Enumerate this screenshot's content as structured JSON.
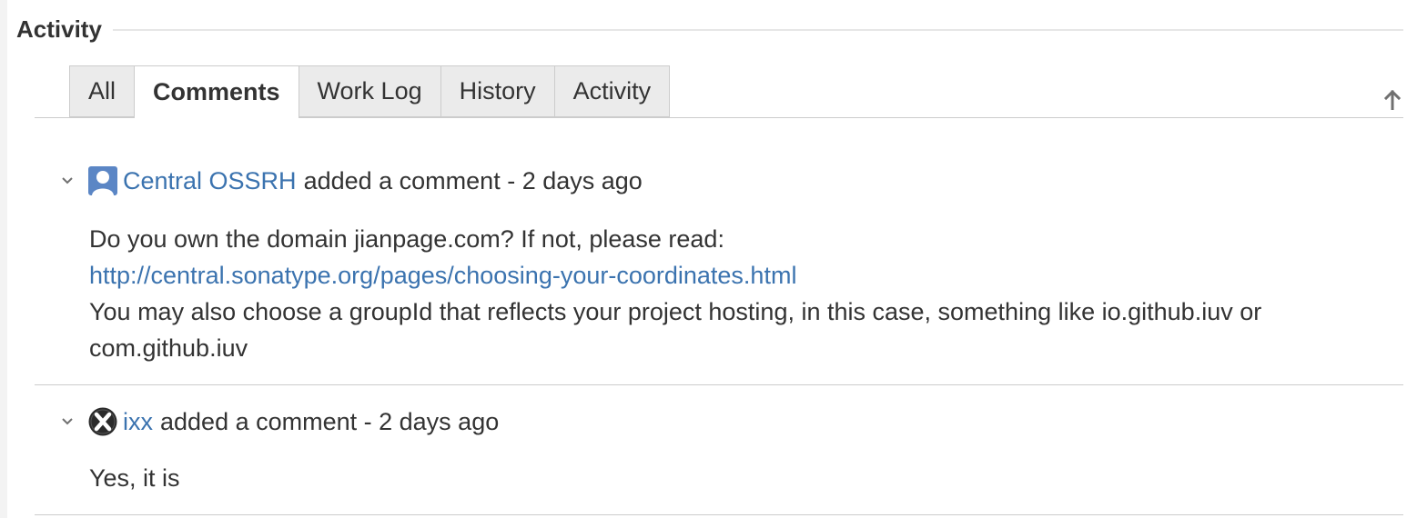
{
  "module": {
    "title": "Activity"
  },
  "tabs": [
    {
      "label": "All",
      "active": false
    },
    {
      "label": "Comments",
      "active": true
    },
    {
      "label": "Work Log",
      "active": false
    },
    {
      "label": "History",
      "active": false
    },
    {
      "label": "Activity",
      "active": false
    }
  ],
  "comments": [
    {
      "author": "Central OSSRH",
      "action": "added a comment - 2 days ago",
      "avatar_icon": "default-user-avatar-icon",
      "body": {
        "line1": "Do you own the domain jianpage.com? If not, please read:",
        "link": "http://central.sonatype.org/pages/choosing-your-coordinates.html",
        "line3": "You may also choose a groupId that reflects your project hosting, in this case, something like io.github.iuv or",
        "line4": "com.github.iuv"
      }
    },
    {
      "author": "ixx",
      "action": "added a comment - 2 days ago",
      "avatar_icon": "x-logo-avatar-icon",
      "body": {
        "line1": "Yes, it is"
      }
    }
  ],
  "colors": {
    "link": "#3b73af",
    "text": "#333333",
    "tab_inactive_bg": "#ebebeb",
    "border": "#cccccc"
  }
}
